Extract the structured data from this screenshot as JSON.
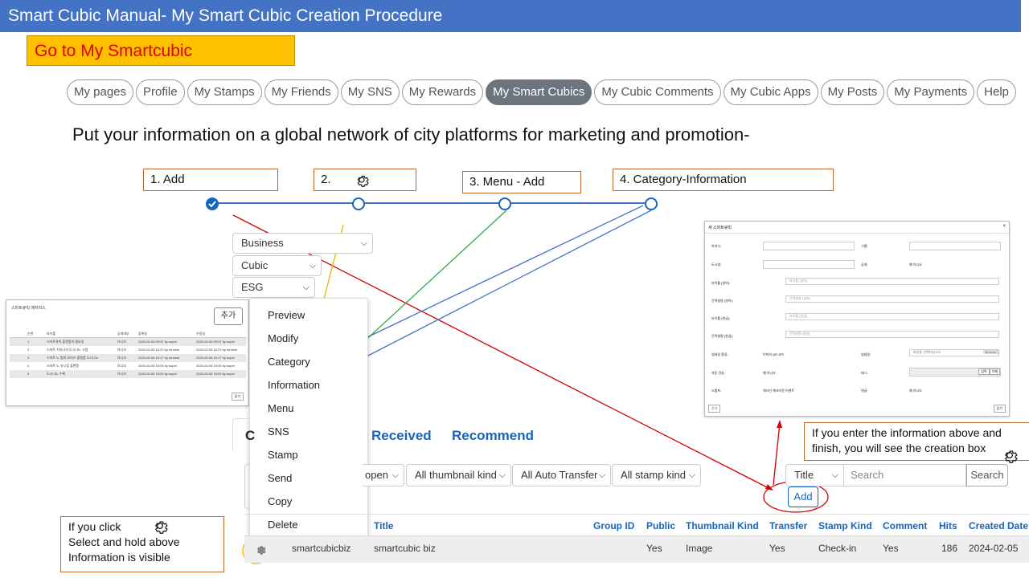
{
  "title": "Smart Cubic Manual- My Smart Cubic Creation Procedure",
  "goto_label": "Go to My Smartcubic",
  "nav_tabs": [
    {
      "label": "My pages"
    },
    {
      "label": "Profile"
    },
    {
      "label": "My Stamps"
    },
    {
      "label": "My Friends"
    },
    {
      "label": "My SNS"
    },
    {
      "label": "My Rewards"
    },
    {
      "label": "My Smart Cubics",
      "active": true
    },
    {
      "label": "My Cubic Comments"
    },
    {
      "label": "My Cubic Apps"
    },
    {
      "label": "My Posts"
    },
    {
      "label": "My Payments"
    },
    {
      "label": "Help"
    }
  ],
  "headline": "Put your information on a global network of city platforms for marketing and promotion-",
  "steps": {
    "s1": "1. Add",
    "s2": "2.",
    "s3": "3. Menu - Add",
    "s4": "4. Category-Information"
  },
  "dropdowns": {
    "business": "Business",
    "cubic": "Cubic",
    "esg": "ESG"
  },
  "context_menu": [
    "Preview",
    "Modify",
    "Category",
    "Information",
    "Menu",
    "SNS",
    "Stamp",
    "Send",
    "Copy",
    "Delete"
  ],
  "left_thumb": {
    "title": "스마트큐빅 메자리스",
    "add_button": "추가",
    "headers": [
      "순번",
      "타이틀",
      "공개여부",
      "등록일",
      "수정일"
    ],
    "rows": [
      [
        "1",
        "스마트큐빅 플랜폼의 필요성",
        "아니오",
        "2024-02-06 09:57 by super",
        "2024-02-06 09:57 by super"
      ],
      [
        "2",
        "스마트 치유나의 도시나노 시범",
        "아니오",
        "2024-02-06 16:23 by mhome",
        "2024-02-06 16:23 by mhome"
      ],
      [
        "3",
        "스마트 노 법의 모리스 플랜폼 도시나노",
        "아니오",
        "2024-02-06 15:17 by mhome",
        "2024-02-06 15:17 by super"
      ],
      [
        "4",
        "스마트 노 유시집 플랜폼",
        "아니오",
        "2024-02-06 15:05 by super",
        "2024-02-06 15:05 by super"
      ],
      [
        "5",
        "도시나노 수록",
        "아니오",
        "2024-02-06 15:05 by super",
        "2024-02-06 15:05 by super"
      ]
    ],
    "footer_button": "닫기"
  },
  "right_thumb": {
    "title": "새 스마트큐빅",
    "labels": [
      "아이디:",
      "그룹:",
      "도시명:",
      "공개:",
      "타이틀 (영어):",
      "간략설명 (영어):",
      "타이틀 (한글):",
      "간략설명 (한글):",
      "썸네일 종류:",
      "썸네일:",
      "자동 전송:",
      "태그:",
      "스탬프:",
      "댓글:"
    ],
    "placeholders": [
      "타이틀 (영어)",
      "간략설명 (영어)",
      "타이틀 (한글)",
      "간략설명 (한글)",
      "파일을 선택하십시오"
    ],
    "radios": [
      "예",
      "아니오",
      "이미지",
      "QR 코드",
      "체크인",
      "체크아웃",
      "이벤트"
    ],
    "browse": "Browse",
    "tag_buttons": [
      "입력",
      "삭제"
    ],
    "close_button": "닫기",
    "save_button": "추가"
  },
  "tabs": {
    "c_partial": "C",
    "received": "Received",
    "recommend": "Recommend"
  },
  "filters": {
    "open": "open",
    "thumbnail": "All thumbnail kind",
    "auto_transfer": "All Auto Transfer",
    "stamp": "All stamp kind",
    "search_type": "Title",
    "search_placeholder": "Search",
    "search_button": "Search",
    "add_button": "Add"
  },
  "table": {
    "headers": [
      "Title",
      "Group ID",
      "Public",
      "Thumbnail Kind",
      "Transfer",
      "Stamp Kind",
      "Comment",
      "Hits",
      "Created Date"
    ],
    "row": {
      "id": "smartcubicbiz",
      "title": "smartcubic biz",
      "group": "",
      "public": "Yes",
      "thumb": "Image",
      "transfer": "Yes",
      "stamp": "Check-in",
      "comment": "Yes",
      "hits": "186",
      "created": "2024-02-05"
    }
  },
  "note_right": "If you enter the information above and finish, you will see the creation box",
  "note_left": [
    "If you click",
    "Select and hold above",
    "Information  is visible"
  ],
  "colors": {
    "title_bar": "#4472c4",
    "goto_bg": "#ffc000",
    "goto_text": "#e00000",
    "accent": "#1565c0",
    "red_line": "#d00000",
    "green_line": "#2eaa4a",
    "orange_line": "#f0b400"
  }
}
